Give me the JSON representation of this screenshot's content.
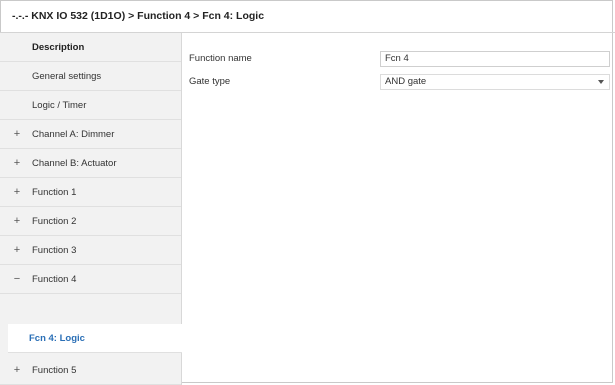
{
  "window": {
    "breadcrumb": "-.-.- KNX IO 532 (1D1O) > Function 4 > Fcn 4: Logic"
  },
  "sidebar": {
    "items": [
      {
        "label": "Description",
        "sign": ""
      },
      {
        "label": "General settings",
        "sign": ""
      },
      {
        "label": "Logic / Timer",
        "sign": ""
      },
      {
        "label": "Channel A: Dimmer",
        "sign": "+"
      },
      {
        "label": "Channel B: Actuator",
        "sign": "+"
      },
      {
        "label": "Function 1",
        "sign": "+"
      },
      {
        "label": "Function 2",
        "sign": "+"
      },
      {
        "label": "Function 3",
        "sign": "+"
      },
      {
        "label": "Function 4",
        "sign": "−"
      },
      {
        "label": "Fcn 4: Logic",
        "sign": ""
      },
      {
        "label": "Function 5",
        "sign": "+"
      }
    ]
  },
  "params": {
    "function_name_label": "Function name",
    "function_name_value": "Fcn 4",
    "gate_type_label": "Gate type",
    "gate_type_value": "AND gate"
  },
  "colors": {
    "selected_text": "#2a6fb6",
    "sidebar_bg": "#f2f2f2"
  }
}
